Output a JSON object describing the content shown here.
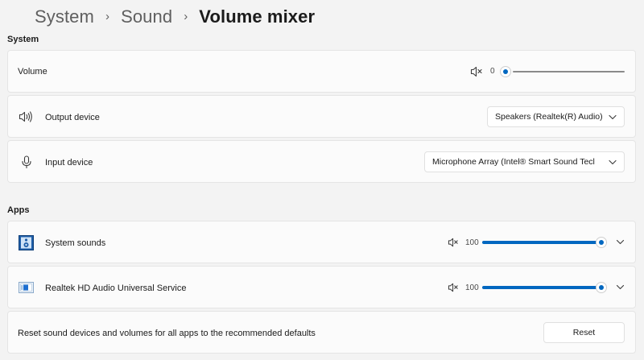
{
  "breadcrumb": {
    "items": [
      "System",
      "Sound"
    ],
    "current": "Volume mixer",
    "separator": "›"
  },
  "sections": {
    "system": "System",
    "apps": "Apps"
  },
  "system_volume": {
    "label": "Volume",
    "value": "0",
    "muted": true,
    "level": 0
  },
  "output_device": {
    "label": "Output device",
    "icon": "speaker-icon",
    "selected": "Speakers (Realtek(R) Audio)"
  },
  "input_device": {
    "label": "Input device",
    "icon": "microphone-icon",
    "selected": "Microphone Array (Intel® Smart Sound Tecl"
  },
  "apps": [
    {
      "label": "System sounds",
      "icon": "system-sounds-icon",
      "value": "100",
      "level": 1.0
    },
    {
      "label": "Realtek HD Audio Universal Service",
      "icon": "realtek-app-icon",
      "value": "100",
      "level": 1.0
    }
  ],
  "reset": {
    "description": "Reset sound devices and volumes for all apps to the recommended defaults",
    "button_label": "Reset"
  },
  "colors": {
    "accent": "#0067c0",
    "background": "#f3f3f3",
    "card": "#fbfbfb"
  }
}
